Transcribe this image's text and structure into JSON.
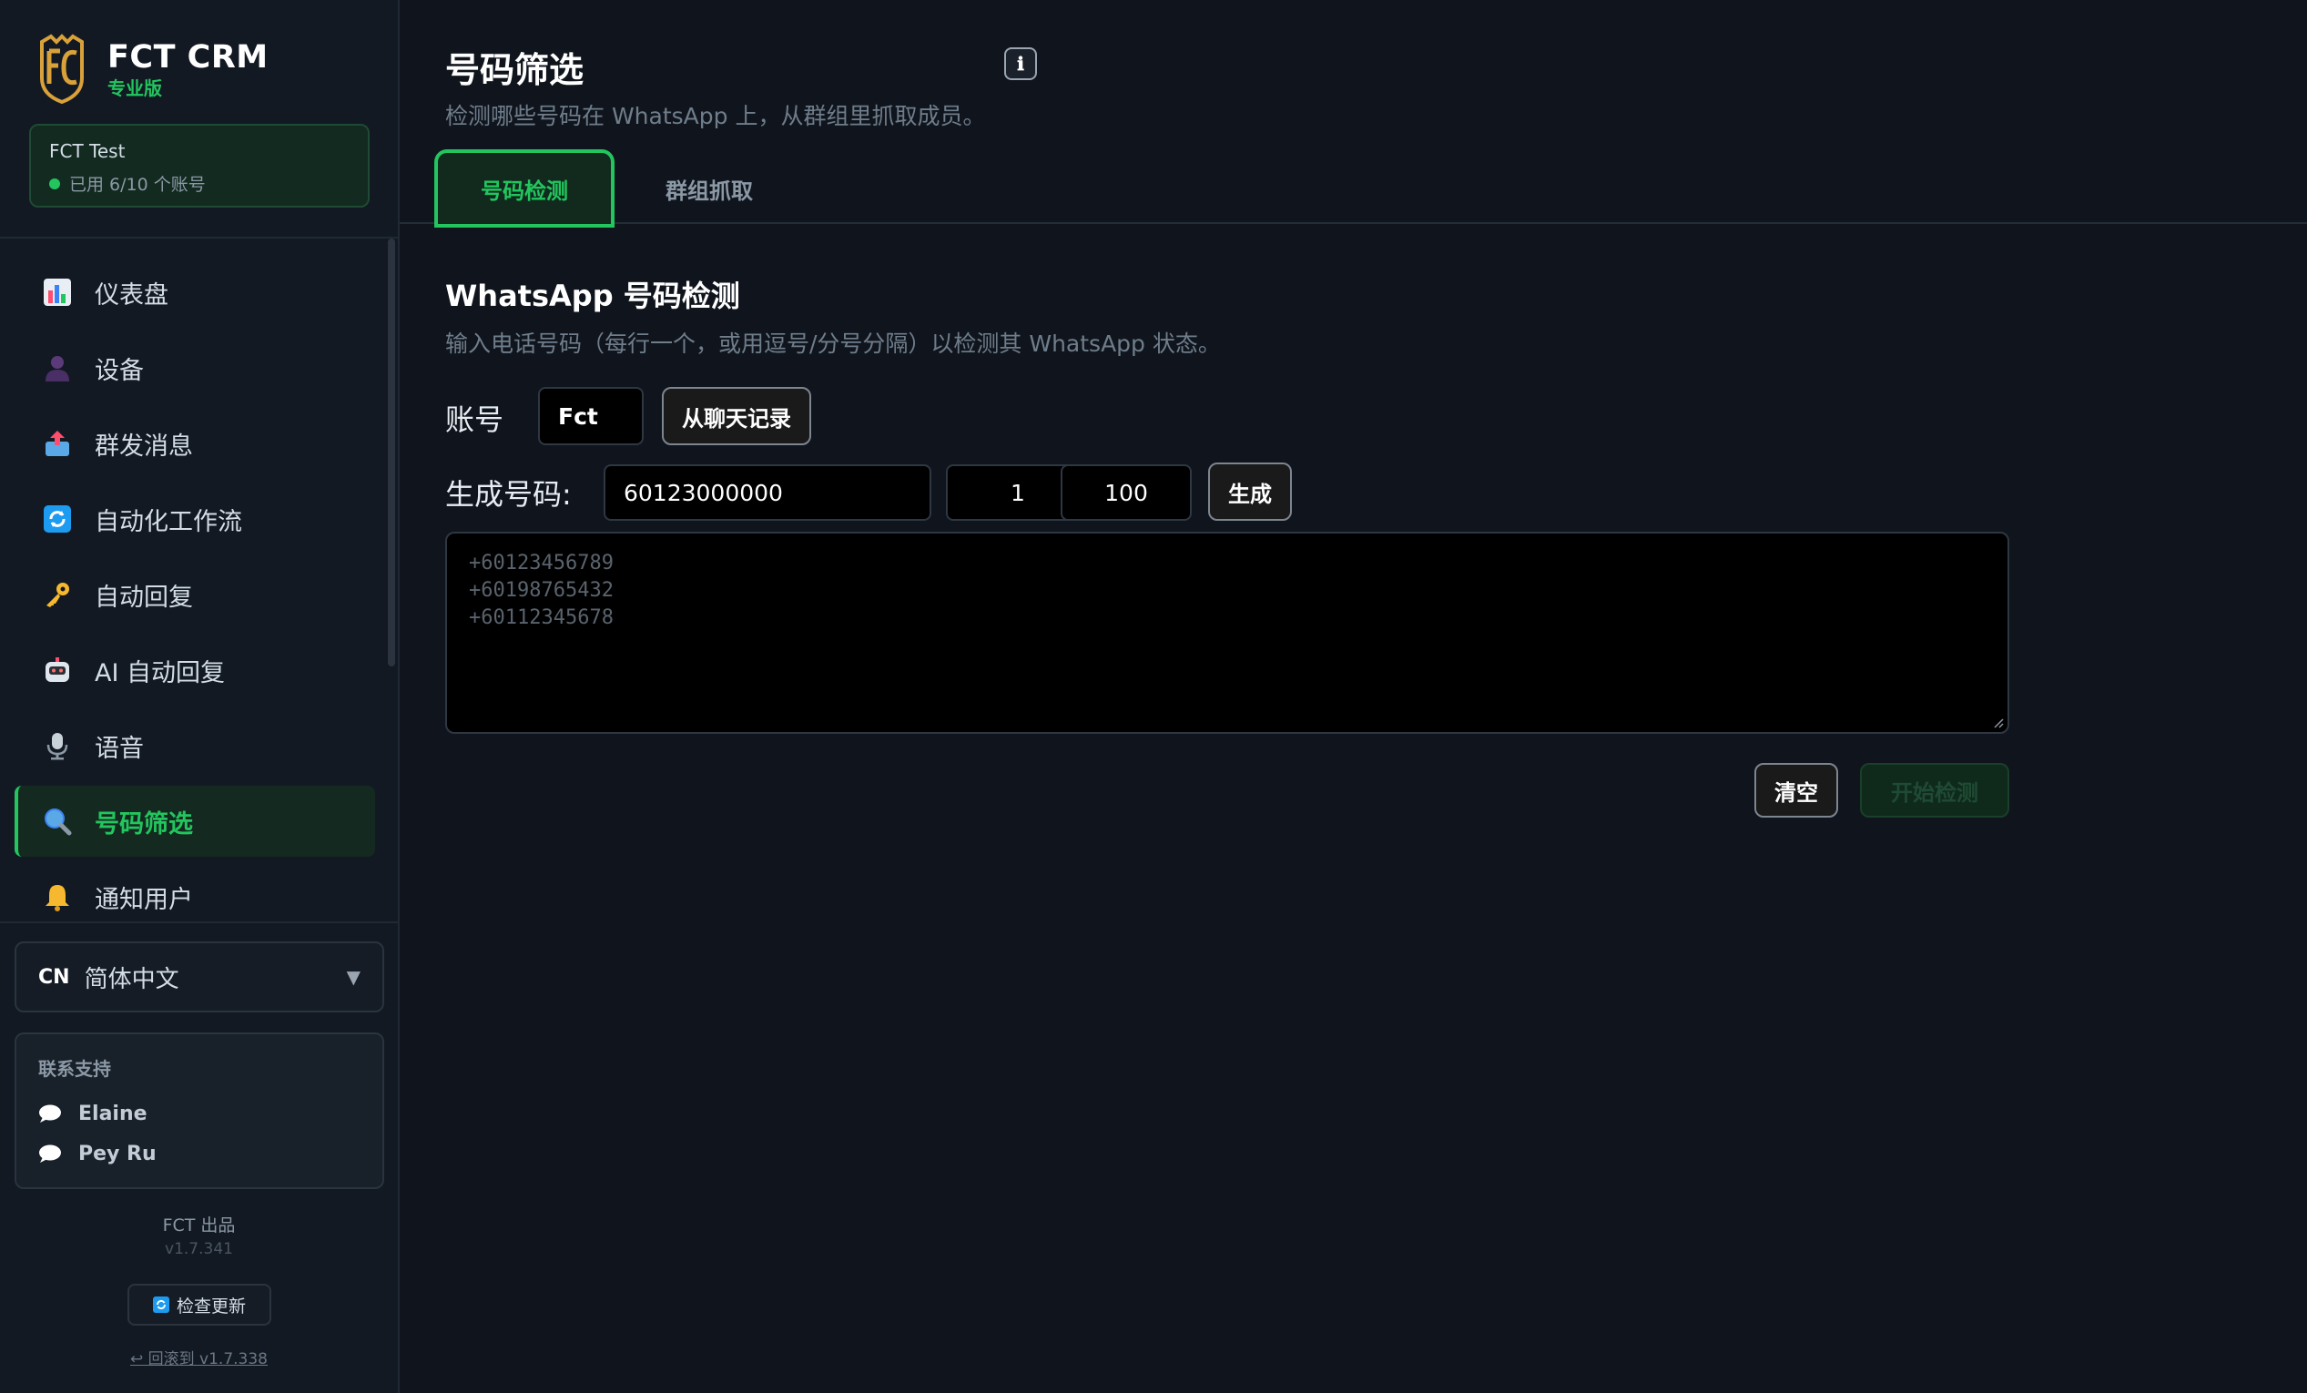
{
  "brand": {
    "name": "FCT CRM",
    "edition": "专业版",
    "logo_icon": "fc-shield-logo"
  },
  "account_card": {
    "name": "FCT Test",
    "usage": "已用 6/10 个账号",
    "status_color": "#22c55e"
  },
  "sidebar": {
    "items": [
      {
        "label": "仪表盘",
        "icon": "chart-icon",
        "active": false
      },
      {
        "label": "设备",
        "icon": "user-silhouette-icon",
        "active": false
      },
      {
        "label": "群发消息",
        "icon": "outbox-tray-icon",
        "active": false
      },
      {
        "label": "自动化工作流",
        "icon": "refresh-icon",
        "active": false
      },
      {
        "label": "自动回复",
        "icon": "key-icon",
        "active": false
      },
      {
        "label": "AI 自动回复",
        "icon": "robot-icon",
        "active": false
      },
      {
        "label": "语音",
        "icon": "microphone-icon",
        "active": false
      },
      {
        "label": "号码筛选",
        "icon": "magnifier-icon",
        "active": true
      },
      {
        "label": "通知用户",
        "icon": "bell-icon",
        "active": false
      }
    ]
  },
  "language": {
    "code": "CN",
    "label": "简体中文",
    "arrow": "▼"
  },
  "support": {
    "title": "联系支持",
    "contacts": [
      {
        "name": "Elaine",
        "icon": "speech-bubble-icon"
      },
      {
        "name": "Pey Ru",
        "icon": "speech-bubble-icon"
      }
    ]
  },
  "footer": {
    "made_by": "FCT 出品",
    "version": "v1.7.341",
    "check_update": "检查更新",
    "rollback": "↩ 回滚到 v1.7.338"
  },
  "page": {
    "title": "号码筛选",
    "info_icon": "ℹ",
    "subtitle": "检测哪些号码在 WhatsApp 上，从群组里抓取成员。"
  },
  "tabs": [
    {
      "label": "号码检测",
      "active": true
    },
    {
      "label": "群组抓取",
      "active": false
    }
  ],
  "checker": {
    "title": "WhatsApp 号码检测",
    "description": "输入电话号码（每行一个，或用逗号/分号分隔）以检测其 WhatsApp 状态。",
    "account_label": "账号",
    "account_value": "Fct",
    "from_chat_label": "从聊天记录",
    "generate_label": "生成号码:",
    "generate_prefix": "60123000000",
    "generate_start": "1",
    "generate_count": "100",
    "generate_button": "生成",
    "placeholder_lines": [
      "+60123456789",
      "+60198765432",
      "+60112345678"
    ],
    "clear_button": "清空",
    "start_button": "开始检测"
  },
  "colors": {
    "accent": "#22c55e",
    "background": "#10151d",
    "sidebar": "#121923"
  }
}
